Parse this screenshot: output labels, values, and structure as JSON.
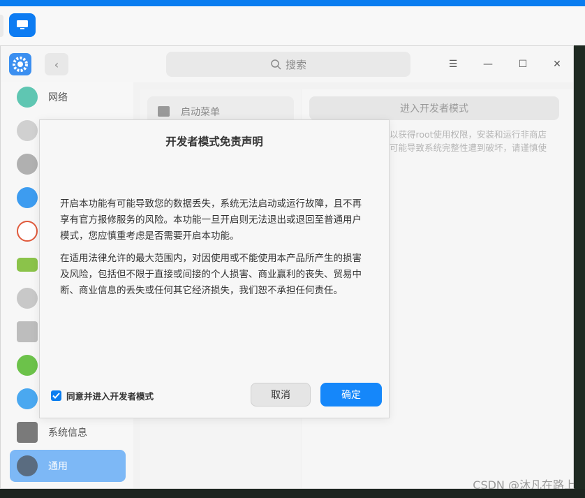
{
  "window": {
    "search_placeholder": "搜索",
    "minimize_glyph": "—",
    "maximize_glyph": "☐",
    "close_glyph": "✕",
    "menu_glyph": "☰",
    "back_glyph": "‹"
  },
  "sidebar": {
    "items": [
      {
        "label": "网络",
        "icon": "network-icon",
        "color": "#5fc6b2"
      },
      {
        "label": "",
        "icon": "notification-bell-icon",
        "color": "#d0d0d0"
      },
      {
        "label": "",
        "icon": "sound-speaker-icon",
        "color": "#b0b0b0"
      },
      {
        "label": "",
        "icon": "bluetooth-icon",
        "color": "#3d9cf0"
      },
      {
        "label": "",
        "icon": "clock-icon",
        "color": "#e05a3c"
      },
      {
        "label": "",
        "icon": "power-battery-icon",
        "color": "#8bc34a"
      },
      {
        "label": "",
        "icon": "mouse-icon",
        "color": "#c8c8c8"
      },
      {
        "label": "",
        "icon": "keyboard-icon",
        "color": "#bdbdbd"
      },
      {
        "label": "",
        "icon": "update-icon",
        "color": "#6cc24a"
      },
      {
        "label": "",
        "icon": "personalization-icon",
        "color": "#4aa8f0"
      },
      {
        "label": "系统信息",
        "icon": "system-info-icon",
        "color": "#7a7a7a"
      },
      {
        "label": "通用",
        "icon": "general-gear-icon",
        "color": "#5a6c80",
        "active": true
      }
    ]
  },
  "middle": {
    "item_label": "启动菜单"
  },
  "right": {
    "dev_mode_button": "进入开发者模式",
    "desc_line1": "以获得root使用权限，安装和运行非商店",
    "desc_line2": "可能导致系统完整性遭到破坏，请谨慎使"
  },
  "dialog": {
    "title": "开发者模式免责声明",
    "paragraph1": "开启本功能有可能导致您的数据丢失，系统无法启动或运行故障，且不再享有官方报修服务的风险。本功能一旦开启则无法退出或退回至普通用户模式，您应慎重考虑是否需要开启本功能。",
    "paragraph2": "在适用法律允许的最大范围内，对因使用或不能使用本产品所产生的损害及风险，包括但不限于直接或间接的个人损害、商业赢利的丧失、贸易中断、商业信息的丢失或任何其它经济损失，我们恕不承担任何责任。",
    "agree_label": "同意并进入开发者模式",
    "agree_checked": true,
    "cancel_label": "取消",
    "ok_label": "确定"
  },
  "watermark": "CSDN @沐凡在路上",
  "colors": {
    "accent": "#1587fa",
    "sidebar_active": "#7db8f6"
  }
}
